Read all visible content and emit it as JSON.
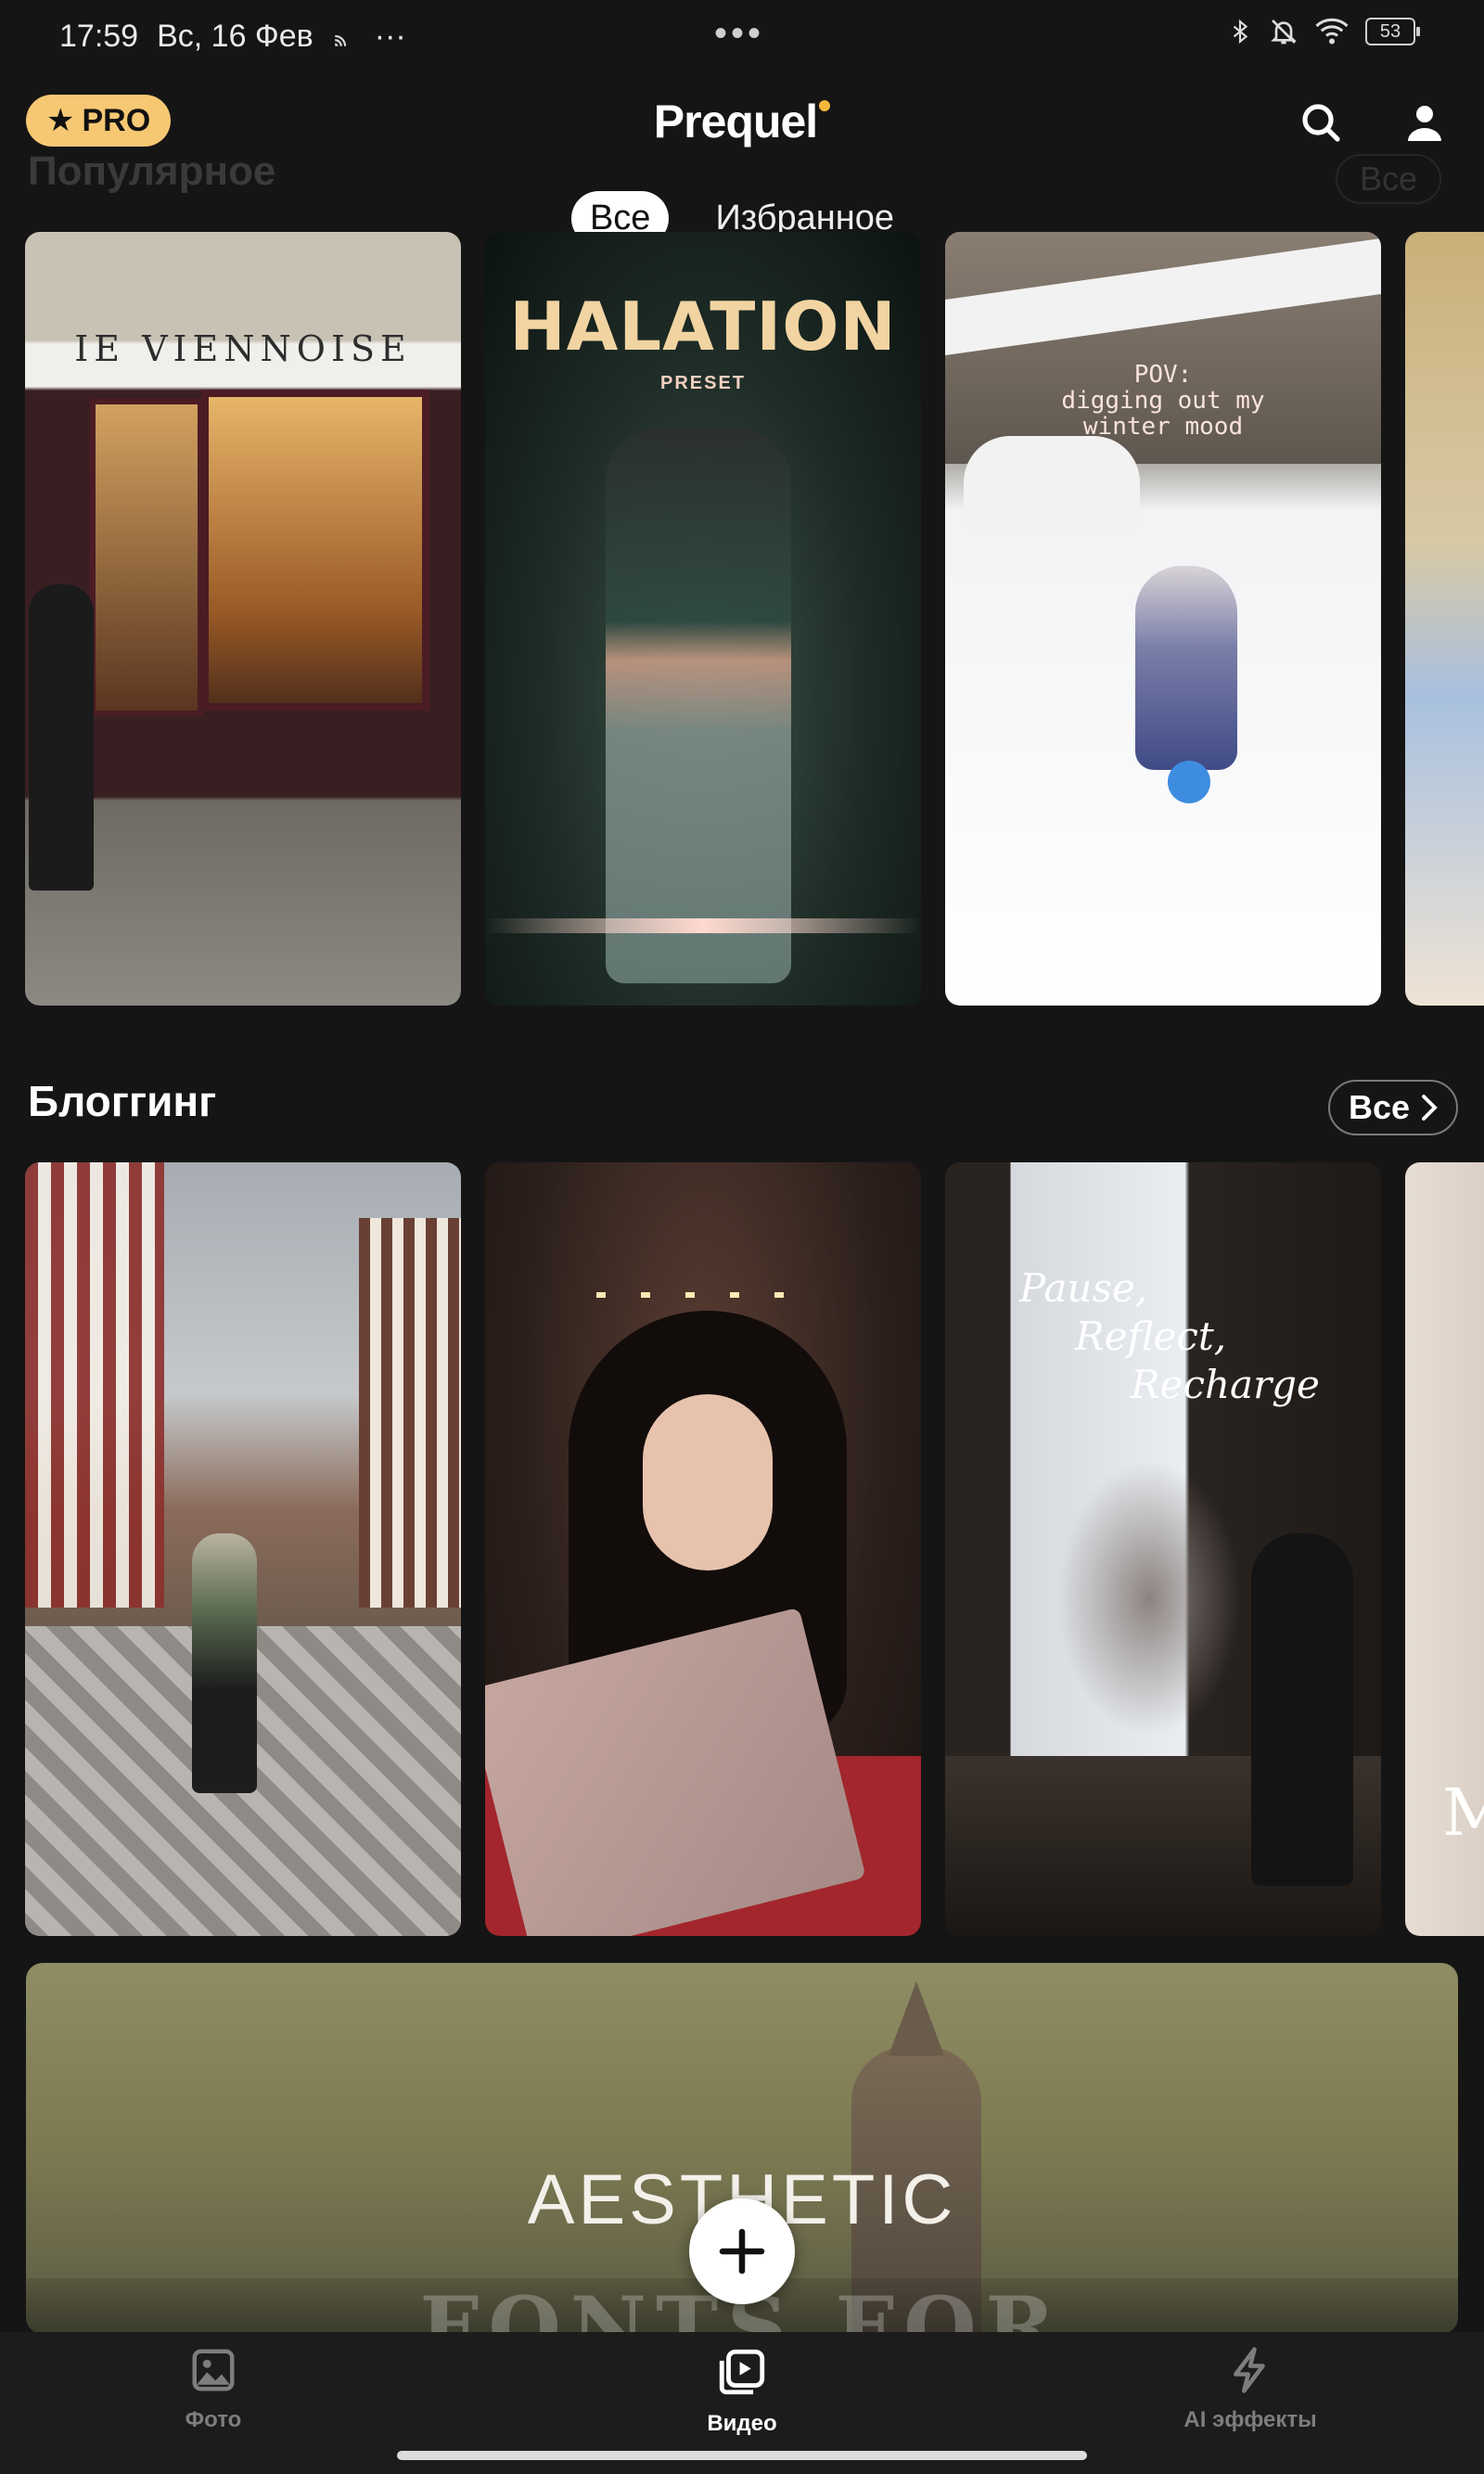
{
  "status_bar": {
    "time": "17:59",
    "date": "Вс, 16 Фев",
    "more": "···",
    "center_dots": "•••",
    "battery": "53"
  },
  "header": {
    "pro_label": "PRO",
    "logo": "Prequel",
    "tabs": [
      {
        "label": "Все",
        "active": true
      },
      {
        "label": "Избранное",
        "active": false
      }
    ]
  },
  "section_popular": {
    "title": "Популярное",
    "all_label": "Все"
  },
  "popular_cards": {
    "card1_text": "IE VIENNOISE",
    "card2_title": "HALATION",
    "card2_sub": "PRESET",
    "card3_text": [
      "POV:",
      "digging out my",
      "winter mood"
    ]
  },
  "section_blogging": {
    "title": "Блоггинг",
    "all_label": "Все"
  },
  "blog_cards": {
    "card3_script": [
      "Pause,",
      "Reflect,",
      "Recharge"
    ],
    "card4_text": "M"
  },
  "banner": {
    "title": "AESTHETIC",
    "ghost_text": "FONTS FOR"
  },
  "bottom_nav": [
    {
      "label": "Фото",
      "icon": "photo-icon",
      "active": false
    },
    {
      "label": "Видео",
      "icon": "video-icon",
      "active": true
    },
    {
      "label": "AI эффекты",
      "icon": "lightning-icon",
      "active": false
    }
  ],
  "colors": {
    "background": "#151515",
    "pro_badge": "#f7c873",
    "logo_dot": "#f5b73b"
  }
}
